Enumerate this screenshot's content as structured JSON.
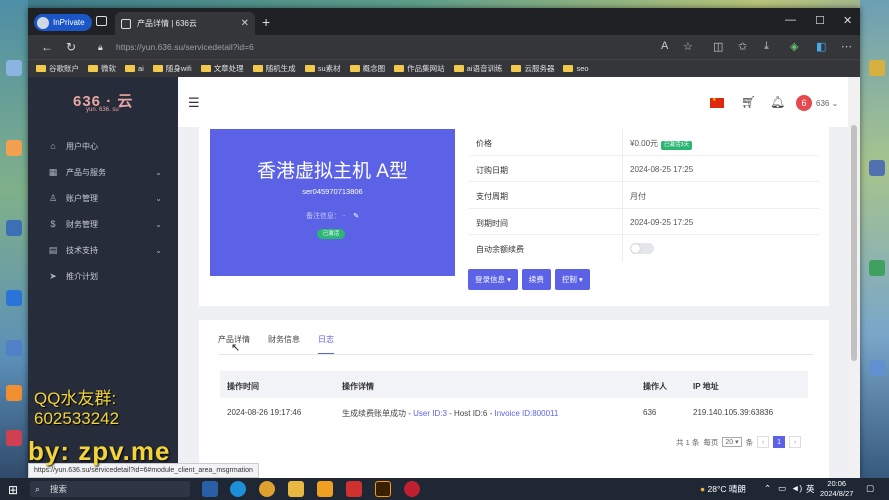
{
  "browser": {
    "profile": "InPrivate",
    "tab_title": "产品详情 | 636云",
    "tab_close": "✕",
    "new_tab": "+",
    "url": "https://yun.636.su/servicedetail?id=6",
    "win_min": "—",
    "win_max": "☐",
    "win_close": "✕",
    "bookmarks": [
      "谷歌账户",
      "微软",
      "ai",
      "随身wifi",
      "文章处理",
      "随机生成",
      "su素材",
      "概念图",
      "作品集网站",
      "ai语音训练",
      "云服务器",
      "seo"
    ],
    "status_url": "https://yun.636.su/servicedetail?id=6#module_client_area_msgrmation"
  },
  "sidebar": {
    "logo": "636 · 云",
    "logo_sub": "yun. 636. su",
    "items": [
      {
        "label": "用户中心",
        "icon": "home-icon",
        "glyph": "⌂",
        "chevron": ""
      },
      {
        "label": "产品与服务",
        "icon": "grid-icon",
        "glyph": "▦",
        "chevron": "⌄"
      },
      {
        "label": "账户管理",
        "icon": "user-icon",
        "glyph": "♙",
        "chevron": "⌄"
      },
      {
        "label": "财务管理",
        "icon": "money-icon",
        "glyph": "$",
        "chevron": "⌄"
      },
      {
        "label": "技术支持",
        "icon": "support-icon",
        "glyph": "▤",
        "chevron": "⌄"
      },
      {
        "label": "推介计划",
        "icon": "send-icon",
        "glyph": "➤",
        "chevron": ""
      }
    ]
  },
  "topbar": {
    "user_initial": "6",
    "user_name": "636",
    "user_chevron": "⌄"
  },
  "product": {
    "title": "香港虚拟主机 A型",
    "id": "ser045970713806",
    "note_label": "备注信息：",
    "note_value": "-",
    "status": "已激活"
  },
  "info": {
    "price_label": "价格",
    "price_value": "¥0.00元",
    "price_badge": "已激活3天",
    "order_date_label": "订购日期",
    "order_date": "2024-08-25 17:25",
    "billing_label": "支付周期",
    "billing": "月付",
    "expiry_label": "到期时间",
    "expiry": "2024-09-25 17:25",
    "auto_renew_label": "自动余额续费",
    "auto_renew_on": false
  },
  "actions": {
    "login": "登录信息",
    "renew": "续费",
    "control": "控制"
  },
  "subtabs": [
    "产品详情",
    "财务信息",
    "日志"
  ],
  "log": {
    "headers": [
      "操作时间",
      "操作详情",
      "操作人",
      "IP 地址"
    ],
    "row": {
      "time": "2024-08-26 19:17:46",
      "detail_prefix": "生成续费账单成功 - ",
      "user_link": "User ID:3",
      "detail_mid": " - Host ID:6 - ",
      "invoice_link": "Invoice ID:800011",
      "operator": "636",
      "ip": "219.140.105.39:63836"
    }
  },
  "pager": {
    "total": "共 1 条",
    "per_page_label": "每页",
    "per_page": "20",
    "per_page_unit": "条",
    "prev": "‹",
    "current": "1",
    "next": "›"
  },
  "watermark": {
    "line1": "QQ水友群:",
    "line2": "602533242",
    "line3": "by: zpv.me"
  },
  "taskbar": {
    "search": "搜索",
    "weather": "28°C 晴朗",
    "lang": "英",
    "time": "20:06",
    "date": "2024/8/27"
  },
  "colors": {
    "accent": "#5b62e6",
    "sidebar_bg": "#262c3a",
    "success": "#2bb673",
    "avatar": "#e5484d"
  }
}
